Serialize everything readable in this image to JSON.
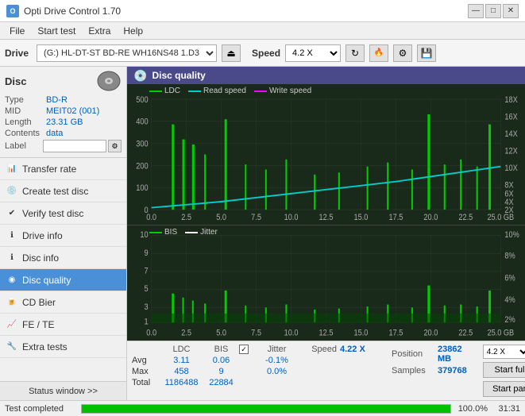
{
  "app": {
    "title": "Opti Drive Control 1.70",
    "icon_text": "O"
  },
  "titlebar": {
    "minimize_label": "—",
    "maximize_label": "□",
    "close_label": "✕"
  },
  "menubar": {
    "items": [
      "File",
      "Start test",
      "Extra",
      "Help"
    ]
  },
  "toolbar": {
    "drive_label": "Drive",
    "drive_value": "(G:) HL-DT-ST BD-RE  WH16NS48 1.D3",
    "speed_label": "Speed",
    "speed_value": "4.2 X"
  },
  "disc": {
    "label": "Disc",
    "type_label": "Type",
    "type_value": "BD-R",
    "mid_label": "MID",
    "mid_value": "MEIT02 (001)",
    "length_label": "Length",
    "length_value": "23.31 GB",
    "contents_label": "Contents",
    "contents_value": "data",
    "label_label": "Label",
    "label_input": ""
  },
  "nav_items": [
    {
      "id": "transfer-rate",
      "label": "Transfer rate",
      "active": false
    },
    {
      "id": "create-test-disc",
      "label": "Create test disc",
      "active": false
    },
    {
      "id": "verify-test-disc",
      "label": "Verify test disc",
      "active": false
    },
    {
      "id": "drive-info",
      "label": "Drive info",
      "active": false
    },
    {
      "id": "disc-info",
      "label": "Disc info",
      "active": false
    },
    {
      "id": "disc-quality",
      "label": "Disc quality",
      "active": true
    },
    {
      "id": "cd-bier",
      "label": "CD Bier",
      "active": false
    },
    {
      "id": "fe-te",
      "label": "FE / TE",
      "active": false
    },
    {
      "id": "extra-tests",
      "label": "Extra tests",
      "active": false
    }
  ],
  "status_window_btn": "Status window >>",
  "disc_quality": {
    "title": "Disc quality",
    "legend_upper": [
      {
        "label": "LDC",
        "color": "#00aa00"
      },
      {
        "label": "Read speed",
        "color": "#00ffff"
      },
      {
        "label": "Write speed",
        "color": "#ff00ff"
      }
    ],
    "legend_lower": [
      {
        "label": "BIS",
        "color": "#00aa00"
      },
      {
        "label": "Jitter",
        "color": "#ffffff"
      }
    ],
    "upper_y_left": [
      "500",
      "400",
      "300",
      "200",
      "100",
      "0"
    ],
    "upper_y_right": [
      "18X",
      "16X",
      "14X",
      "12X",
      "10X",
      "8X",
      "6X",
      "4X",
      "2X"
    ],
    "lower_y_left": [
      "10",
      "9",
      "8",
      "7",
      "6",
      "5",
      "4",
      "3",
      "2",
      "1"
    ],
    "lower_y_right": [
      "10%",
      "8%",
      "6%",
      "4%",
      "2%"
    ],
    "x_axis": [
      "0.0",
      "2.5",
      "5.0",
      "7.5",
      "10.0",
      "12.5",
      "15.0",
      "17.5",
      "20.0",
      "22.5",
      "25.0 GB"
    ]
  },
  "stats": {
    "columns": [
      "LDC",
      "BIS",
      "",
      "Jitter",
      "Speed"
    ],
    "avg_label": "Avg",
    "avg_ldc": "3.11",
    "avg_bis": "0.06",
    "avg_jitter": "-0.1%",
    "max_label": "Max",
    "max_ldc": "458",
    "max_bis": "9",
    "max_jitter": "0.0%",
    "total_label": "Total",
    "total_ldc": "1186488",
    "total_bis": "22884",
    "jitter_checked": true,
    "speed_label": "Speed",
    "speed_value": "4.22 X",
    "speed_select": "4.2 X",
    "position_label": "Position",
    "position_value": "23862 MB",
    "samples_label": "Samples",
    "samples_value": "379768",
    "start_full_label": "Start full",
    "start_part_label": "Start part"
  },
  "progress": {
    "status_text": "Test completed",
    "percent": "100.0%",
    "percent_num": 100,
    "time": "31:31"
  }
}
